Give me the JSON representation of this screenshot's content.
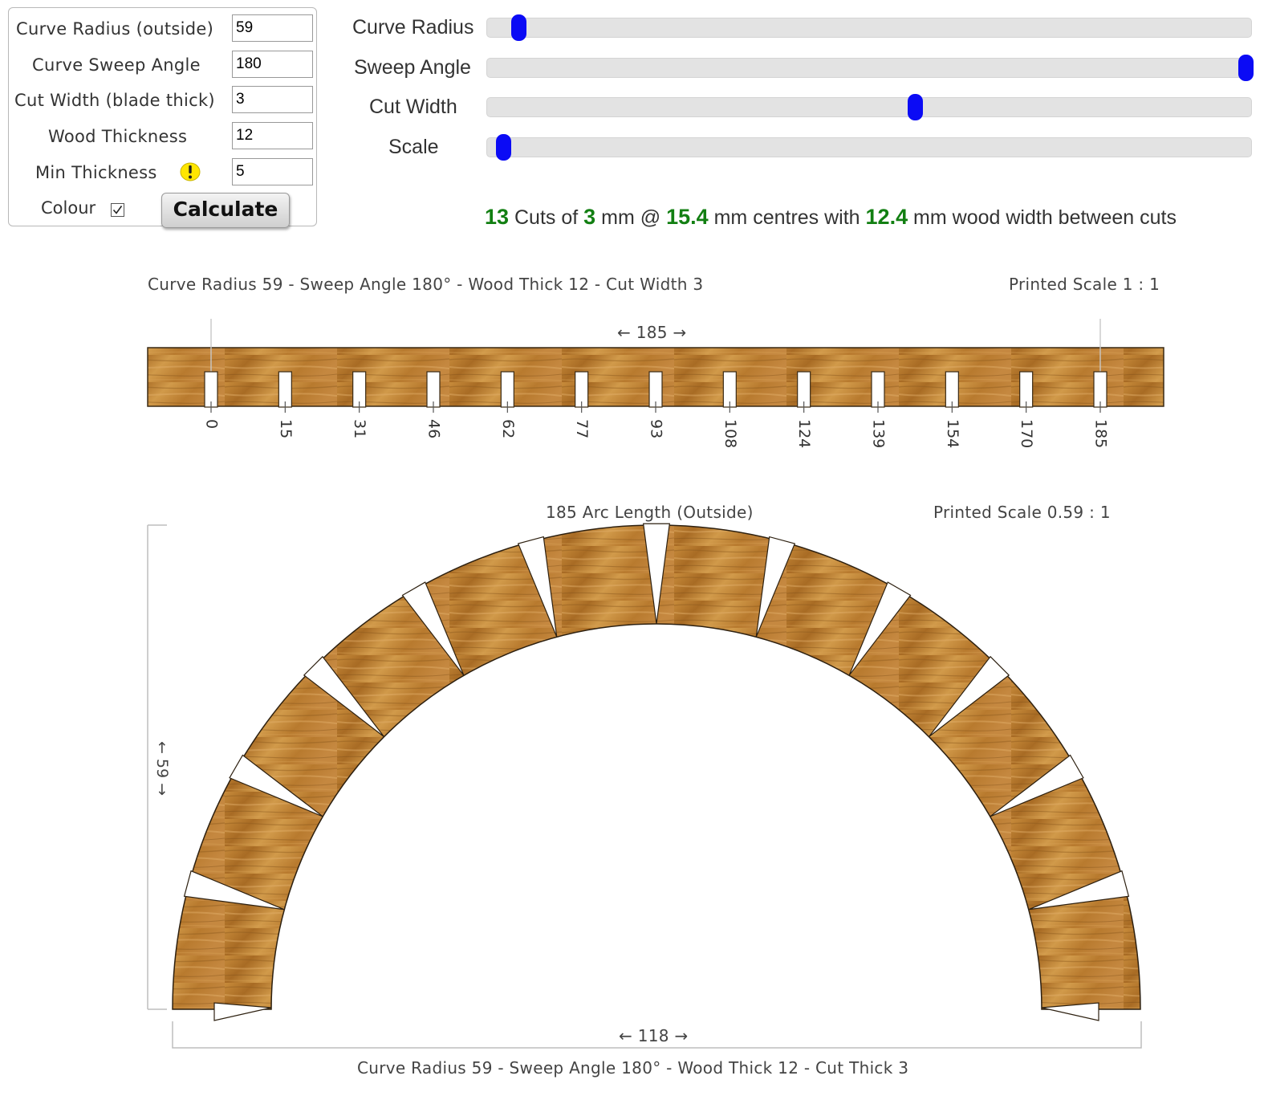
{
  "form": {
    "fields": [
      {
        "label": "Curve Radius (outside)",
        "value": "59"
      },
      {
        "label": "Curve Sweep Angle",
        "value": "180"
      },
      {
        "label": "Cut Width (blade thick)",
        "value": "3"
      },
      {
        "label": "Wood Thickness",
        "value": "12"
      },
      {
        "label": "Min Thickness",
        "value": "5"
      }
    ],
    "colour_label": "Colour",
    "colour_checked": true,
    "calculate_label": "Calculate",
    "warning_icon": "warning-icon"
  },
  "sliders": [
    {
      "label": "Curve Radius",
      "fraction": 0.02
    },
    {
      "label": "Sweep Angle",
      "fraction": 1.0
    },
    {
      "label": "Cut Width",
      "fraction": 0.555
    },
    {
      "label": "Scale",
      "fraction": 0.0
    }
  ],
  "result": {
    "cuts": "13",
    "cuts_text": "Cuts of",
    "cut_width": "3",
    "mm_at": "mm @",
    "centres": "15.4",
    "centres_text": "mm centres with",
    "wood_width": "12.4",
    "wood_text": "mm wood width between cuts"
  },
  "strip": {
    "caption": "Curve Radius 59  -  Sweep Angle 180°  -  Wood Thick 12  -  Cut Width 3",
    "scale": "Printed Scale 1 : 1",
    "length_label": "← 185 →",
    "tick_labels": [
      "0",
      "15",
      "31",
      "46",
      "62",
      "77",
      "93",
      "108",
      "124",
      "139",
      "154",
      "170",
      "185"
    ]
  },
  "arc": {
    "title": "185 Arc Length    (Outside)",
    "scale": "Printed Scale 0.59 : 1",
    "height_label": "← 59 →",
    "width_label": "← 118 →",
    "caption": "Curve Radius 59  -  Sweep Angle 180°  -  Wood Thick 12  -  Cut Thick 3",
    "cut_count": 13
  },
  "colors": {
    "wood_light": "#d49a45",
    "wood_mid": "#b8782a",
    "wood_dark": "#8e5a1c",
    "slider_thumb": "#0b0bf5",
    "highlight": "#127f12"
  }
}
